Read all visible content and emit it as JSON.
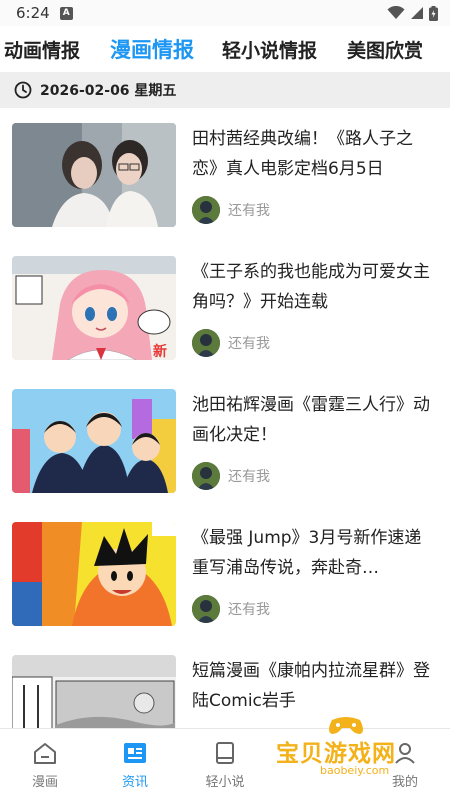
{
  "status_bar": {
    "time": "6:24",
    "notice_glyph": "A"
  },
  "tabs": [
    {
      "label": "动画情报",
      "active": false
    },
    {
      "label": "漫画情报",
      "active": true
    },
    {
      "label": "轻小说情报",
      "active": false
    },
    {
      "label": "美图欣赏",
      "active": false
    }
  ],
  "date_bar": {
    "date": "2026-02-06 星期五"
  },
  "news": [
    {
      "title": "田村茜经典改编！《路人子之恋》真人电影定档6月5日",
      "author": "还有我",
      "image": "photo-two-students"
    },
    {
      "title": "《王子系的我也能成为可爱女主角吗？》开始连载",
      "author": "还有我",
      "image": "manga-pink-hair-girl"
    },
    {
      "title": "池田祐辉漫画《雷霆三人行》动画化决定！",
      "author": "还有我",
      "image": "manga-three-boys"
    },
    {
      "title": "《最强 Jump》3月号新作速递 重写浦岛传说，奔赴奇…",
      "author": "还有我",
      "image": "magazine-cover-jump"
    },
    {
      "title": "短篇漫画《康帕内拉流星群》登陆Comic岩手",
      "author": "还有我",
      "image": "manga-page-bw"
    }
  ],
  "bottom_nav": [
    {
      "label": "漫画",
      "icon": "home-icon",
      "active": false
    },
    {
      "label": "资讯",
      "icon": "news-icon",
      "active": true
    },
    {
      "label": "轻小说",
      "icon": "book-icon",
      "active": false
    },
    {
      "label": "",
      "icon": "",
      "active": false
    },
    {
      "label": "我的",
      "icon": "user-icon",
      "active": false
    }
  ],
  "watermark": {
    "text": "宝贝游戏网",
    "url": "baobeiy.com"
  },
  "colors": {
    "accent": "#1d97f3",
    "date_bar_bg": "#eeeeee",
    "watermark": "#f3b11a"
  }
}
